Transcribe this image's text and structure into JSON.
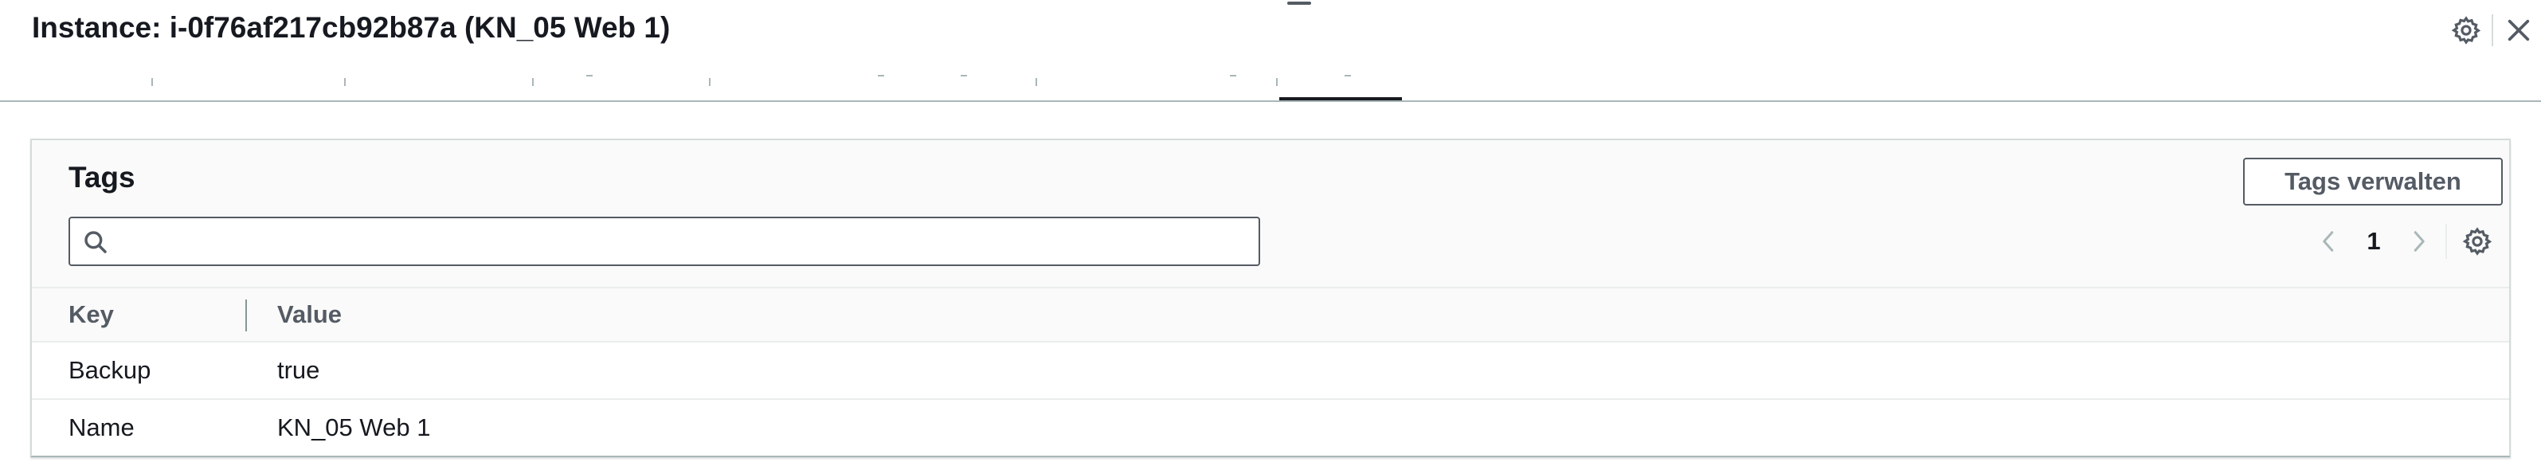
{
  "header": {
    "title": "Instance: i-0f76af217cb92b87a (KN_05 Web 1)",
    "icons": [
      "settings-icon",
      "close-icon"
    ]
  },
  "tabs": {
    "active_index": 8
  },
  "tags_panel": {
    "title": "Tags",
    "manage_button_label": "Tags verwalten",
    "search": {
      "value": "",
      "placeholder": ""
    },
    "pagination": {
      "current_page": "1"
    },
    "table": {
      "columns": [
        "Key",
        "Value"
      ],
      "rows": [
        {
          "key": "Backup",
          "value": "true"
        },
        {
          "key": "Name",
          "value": "KN_05 Web 1"
        }
      ]
    }
  },
  "colors": {
    "text_primary": "#16191f",
    "text_secondary": "#545b64",
    "border": "#aab7b8",
    "header_bg": "#fafafa"
  }
}
